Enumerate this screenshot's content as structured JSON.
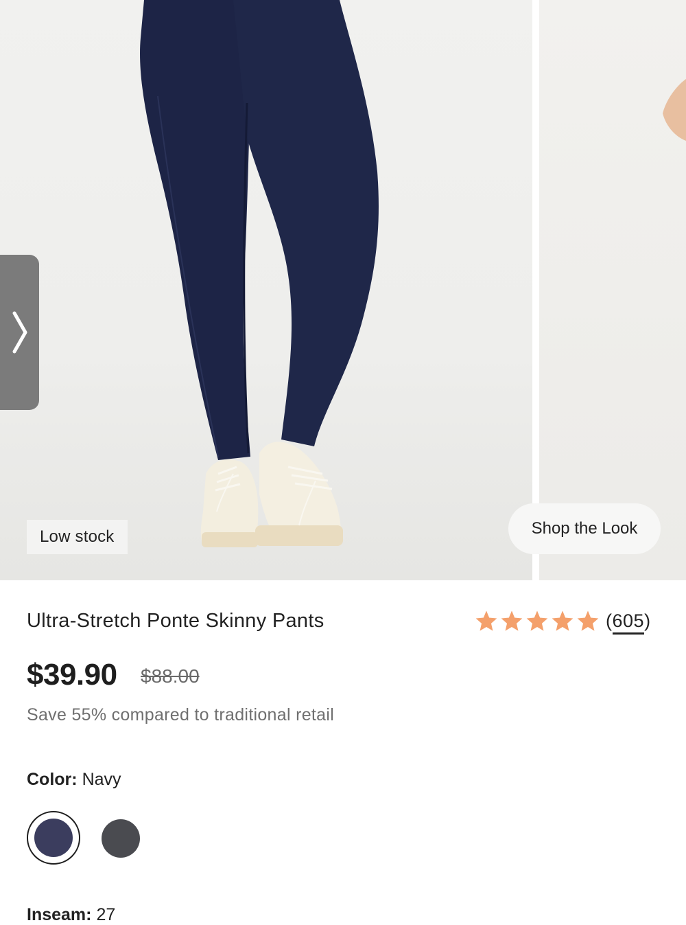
{
  "gallery": {
    "badge": "Low stock",
    "shop_the_look": "Shop the Look",
    "arrow_icon": "chevron-right-icon"
  },
  "product": {
    "title": "Ultra-Stretch Ponte Skinny Pants",
    "rating": 5,
    "review_count_open": "(",
    "review_count": "605",
    "review_count_close": ")",
    "star_icon": "star-icon",
    "price": "$39.90",
    "original_price": "$88.00",
    "savings": "Save 55% compared to traditional retail"
  },
  "color": {
    "label": "Color:",
    "value": "Navy",
    "swatches": [
      {
        "name": "Navy",
        "hex": "#3b3d5e",
        "selected": true
      },
      {
        "name": "Charcoal",
        "hex": "#4a4b50",
        "selected": false
      }
    ]
  },
  "inseam": {
    "label": "Inseam:",
    "value": "27"
  },
  "colors": {
    "star": "#f4a06b",
    "text": "#1e1e1e",
    "muted": "#6f6f6f",
    "arrow_bg": "#7b7b7b"
  }
}
